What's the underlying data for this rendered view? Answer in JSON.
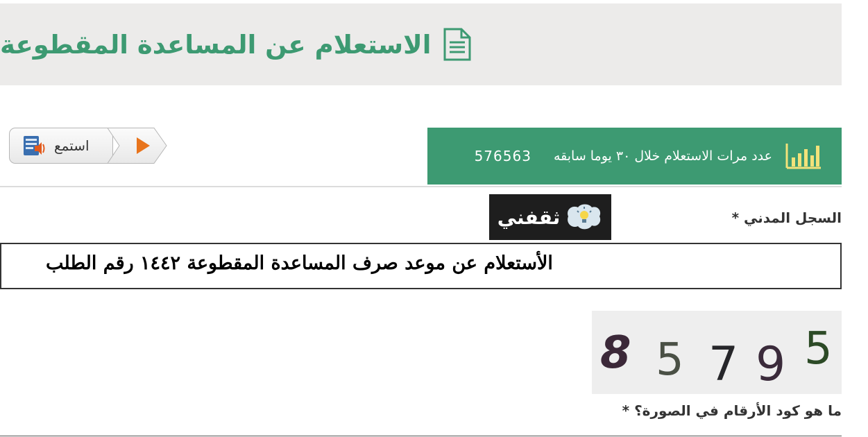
{
  "header": {
    "title": "الاستعلام عن المساعدة المقطوعة",
    "icon": "document-icon",
    "accent_color": "#3d9a72"
  },
  "stats": {
    "label": "عدد مرات الاستعلام خلال ٣٠ يوما سابقه",
    "count": "576563",
    "icon": "bar-chart-icon"
  },
  "listen": {
    "label": "استمع",
    "speaker_icon": "speaker-icon",
    "play_icon": "play-icon"
  },
  "watermark": {
    "text": "ثقفني",
    "icon": "lightbulb-bubble-icon"
  },
  "form": {
    "civil_label": "السجل المدني *",
    "civil_value": "الأستعلام عن موعد صرف المساعدة المقطوعة ١٤٤٢ رقم الطلب",
    "captcha_label": "ما هو كود الأرقام في الصورة؟ *",
    "captcha_digits": [
      "8",
      "5",
      "7",
      "9",
      "5"
    ]
  }
}
